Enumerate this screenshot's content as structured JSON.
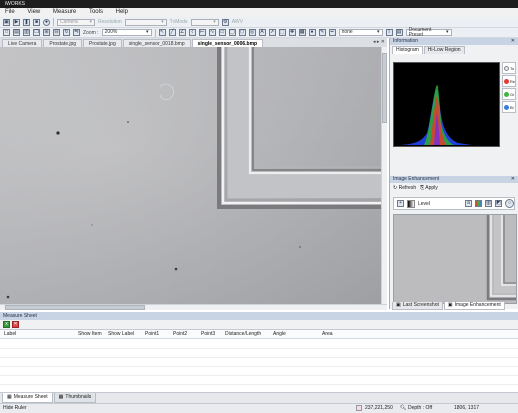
{
  "app": {
    "title": "iWORKS"
  },
  "menu": [
    "File",
    "View",
    "Measure",
    "Tools",
    "Help"
  ],
  "toolbar": {
    "camera_label": "Camera",
    "resolution_label": "Resolution",
    "tvmode_label": "TvMode",
    "awv_label": "AWV",
    "zoom_label": "Zoom :",
    "zoom_value": "200%",
    "line_style_value": "none",
    "document_preset_label": "Document Preset"
  },
  "image_tabs": [
    {
      "label": "Live Camera",
      "active": false
    },
    {
      "label": "Prostate.jpg",
      "active": false
    },
    {
      "label": "Prostate.jpg",
      "active": false
    },
    {
      "label": "single_sensor_0018.bmp",
      "active": false
    },
    {
      "label": "single_sensor_0006.bmp",
      "active": true
    }
  ],
  "information_panel": {
    "title": "Information",
    "tabs": [
      "Histogram",
      "Hi-Low Region"
    ],
    "channels": [
      {
        "label": "To",
        "color": "#ffffff"
      },
      {
        "label": "Re",
        "color": "#e53b2f"
      },
      {
        "label": "Gr",
        "color": "#3fb53a"
      },
      {
        "label": "Bl",
        "color": "#3a7be3"
      }
    ]
  },
  "histogram": {
    "type": "area",
    "channels": [
      "Red",
      "Green",
      "Blue"
    ]
  },
  "image_enhancement": {
    "title": "Image Enhancement",
    "refresh_label": "Refresh",
    "apply_label": "Apply",
    "level_label": "Level"
  },
  "right_bottom_tabs": [
    "Last Screenshot",
    "Image Enhancement"
  ],
  "measure_sheet": {
    "title": "Measure Sheet",
    "columns": [
      "Label",
      "Show Item",
      "Show Label",
      "Point1",
      "Point2",
      "Point3",
      "Distance/Length",
      "Angle",
      "Area"
    ]
  },
  "bottom_tabs": [
    "Measure Sheet",
    "Thumbnails"
  ],
  "status": {
    "hint": "Hide Ruler",
    "rgb": "237,221,250",
    "depth": "Depth : Off",
    "size": "1806, 1317"
  },
  "colors": {
    "panel_header": "#c8d3e3",
    "histogram_bg": "#000000"
  }
}
